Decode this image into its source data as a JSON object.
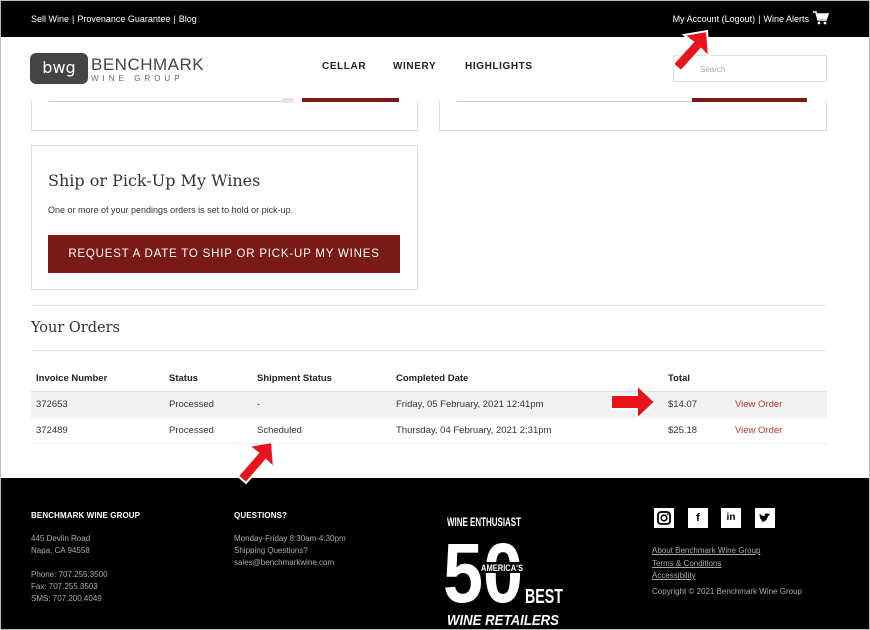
{
  "topbar": {
    "links_left": [
      "Sell Wine",
      "Provenance Guarantee",
      "Blog"
    ],
    "my_account": "My Account",
    "logout": "(Logout)",
    "wine_alerts": "Wine Alerts"
  },
  "header": {
    "logo_mark": "bwg",
    "brand_name": "BENCHMARK",
    "brand_sub": "WINE GROUP",
    "nav": [
      "CELLAR",
      "WINERY",
      "HIGHLIGHTS"
    ],
    "search_placeholder": "Search"
  },
  "ship": {
    "title": "Ship or Pick-Up My Wines",
    "note": "One or more of your pendings orders is set to hold or pick-up.",
    "button": "REQUEST A DATE TO SHIP OR PICK-UP MY WINES"
  },
  "orders": {
    "title": "Your Orders",
    "columns": [
      "Invoice Number",
      "Status",
      "Shipment Status",
      "Completed Date",
      "Total",
      ""
    ],
    "rows": [
      {
        "invoice": "372653",
        "status": "Processed",
        "shipment": "-",
        "date": "Friday, 05 February, 2021 12:41pm",
        "total": "$14.07",
        "action": "View Order"
      },
      {
        "invoice": "372489",
        "status": "Processed",
        "shipment": "Scheduled",
        "date": "Thursday, 04 February, 2021 2:31pm",
        "total": "$25.18",
        "action": "View Order"
      }
    ]
  },
  "footer": {
    "company": {
      "heading": "BENCHMARK WINE GROUP",
      "address1": "445 Devlin Road",
      "address2": "Napa, CA 94558",
      "phone": "Phone: 707.255.3500",
      "fax": "Fax: 707.255.3503",
      "sms": "SMS: 707.200.4049"
    },
    "questions": {
      "heading": "QUESTIONS?",
      "hours": "Monday-Friday 8:30am-4:30pm",
      "shipping": "Shipping Questions?",
      "email": "sales@benchmarkwine.com"
    },
    "award": {
      "brand": "WINE ENTHUSIAST",
      "number": "50",
      "line1": "AMERICA'S",
      "line2": "BEST",
      "line3": "WINE RETAILERS"
    },
    "social": [
      "instagram-icon",
      "facebook-icon",
      "linkedin-icon",
      "twitter-icon"
    ],
    "links": [
      "About Benchmark Wine Group",
      "Terms & Conditions",
      "Accessibility"
    ],
    "copyright": "Copyright © 2021 Benchmark Wine Group"
  },
  "colors": {
    "accent": "#7a1a17",
    "link": "#c0392b",
    "annotation_arrow": "#e8141b"
  }
}
